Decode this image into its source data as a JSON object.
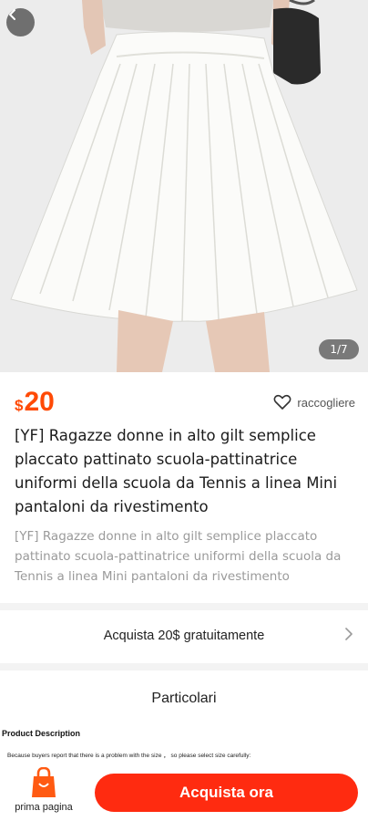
{
  "product": {
    "image_counter": "1/7",
    "price_currency": "$",
    "price_amount": "20",
    "favorite_label": "raccogliere",
    "title": "[YF] Ragazze donne in alto gilt semplice placcato pattinato scuola-pattinatrice uniformi della scuola da Tennis a linea Mini pantaloni da rivestimento",
    "subtitle": "[YF] Ragazze donne in alto gilt semplice placcato pattinato scuola-pattinatrice uniformi della scuola da Tennis a linea Mini pantaloni da rivestimento"
  },
  "coupon": {
    "label": "Acquista 20$ gratuitamente"
  },
  "details": {
    "heading": "Particolari",
    "description_title": "Product Description",
    "description_note": "Because buyers report that there is a problem with the size ， so please select size carefully:"
  },
  "bottom_bar": {
    "home_label": "prima pagina",
    "buy_label": "Acquista ora"
  },
  "colors": {
    "accent": "#ff4a06",
    "buy_button": "#ff2b10"
  },
  "icons": [
    "back-arrow-icon",
    "heart-icon",
    "chevron-right-icon",
    "shopping-bag-icon"
  ]
}
